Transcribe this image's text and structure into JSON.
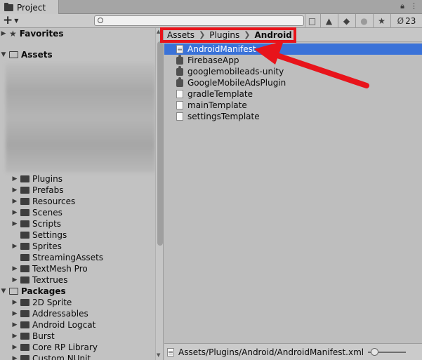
{
  "window": {
    "tab_label": "Project",
    "tab_icon": "folder-icon",
    "tab_tools": [
      "lock-icon",
      "menu-icon"
    ]
  },
  "toolbar": {
    "create_label": "+",
    "search_placeholder": "",
    "hidden_count": "23",
    "buttons": [
      "open-search-window-icon",
      "filter-by-type-icon",
      "filter-by-label-icon",
      "filter-by-importlog-icon",
      "favorite-star-icon",
      "hidden-packages-icon"
    ]
  },
  "tree": {
    "favorites": "Favorites",
    "assets": "Assets",
    "asset_folders": [
      "Plugins",
      "Prefabs",
      "Resources",
      "Scenes",
      "Scripts",
      "Settings",
      "Sprites",
      "StreamingAssets",
      "TextMesh Pro",
      "Textrues"
    ],
    "packages": "Packages",
    "package_folders": [
      "2D Sprite",
      "Addressables",
      "Android Logcat",
      "Burst",
      "Core RP Library",
      "Custom NUnit"
    ]
  },
  "breadcrumb": [
    "Assets",
    "Plugins",
    "Android"
  ],
  "files": [
    {
      "name": "AndroidManifest",
      "icon": "text-file-icon",
      "selected": true
    },
    {
      "name": "FirebaseApp",
      "icon": "plugin-icon",
      "selected": false
    },
    {
      "name": "googlemobileads-unity",
      "icon": "plugin-icon",
      "selected": false
    },
    {
      "name": "GoogleMobileAdsPlugin",
      "icon": "plugin-icon",
      "selected": false
    },
    {
      "name": "gradleTemplate",
      "icon": "file-icon",
      "selected": false
    },
    {
      "name": "mainTemplate",
      "icon": "file-icon",
      "selected": false
    },
    {
      "name": "settingsTemplate",
      "icon": "file-icon",
      "selected": false
    }
  ],
  "status": {
    "path": "Assets/Plugins/Android/AndroidManifest.xml"
  },
  "colors": {
    "selection": "#3a72d8",
    "annotation": "#e8141b"
  }
}
